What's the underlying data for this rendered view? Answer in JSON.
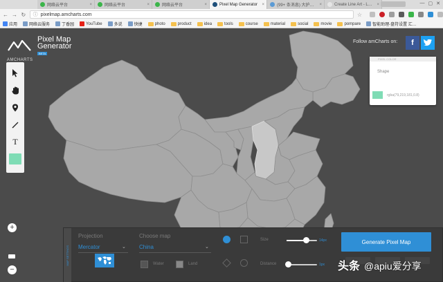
{
  "browser": {
    "tabs": [
      {
        "title": "网络云平台",
        "favicon_color": "#3bb54a",
        "active": false
      },
      {
        "title": "网络云平台",
        "favicon_color": "#3bb54a",
        "active": false
      },
      {
        "title": "网络云平台",
        "favicon_color": "#3bb54a",
        "active": false
      },
      {
        "title": "Pixel Map Generator",
        "favicon_color": "#1e4f7a",
        "active": true
      },
      {
        "title": "(99+ 条消息) 大护…",
        "favicon_color": "#5b9bd5",
        "active": false
      },
      {
        "title": "Create Line Art - L…",
        "favicon_color": "#e6e6e6",
        "active": false
      }
    ],
    "url": "pixelmap.amcharts.com",
    "bookmarks": [
      {
        "label": "应用",
        "kind": "apps"
      },
      {
        "label": "网络云服务",
        "kind": "site"
      },
      {
        "label": "丁香园",
        "kind": "site"
      },
      {
        "label": "YouTube",
        "kind": "youtube"
      },
      {
        "label": "多说",
        "kind": "site"
      },
      {
        "label": "快捷",
        "kind": "site"
      },
      {
        "label": "photo",
        "kind": "folder"
      },
      {
        "label": "product",
        "kind": "folder"
      },
      {
        "label": "idea",
        "kind": "folder"
      },
      {
        "label": "tools",
        "kind": "folder"
      },
      {
        "label": "course",
        "kind": "folder"
      },
      {
        "label": "material",
        "kind": "folder"
      },
      {
        "label": "social",
        "kind": "folder"
      },
      {
        "label": "movie",
        "kind": "folder"
      },
      {
        "label": "pompare",
        "kind": "folder"
      },
      {
        "label": "智能助理-盘符设置 汇…",
        "kind": "site"
      }
    ]
  },
  "header": {
    "brand": "AMCHARTS",
    "title_line1": "Pixel Map",
    "title_line2": "Generator",
    "beta": "BETA",
    "follow_text": "Follow amCharts on:",
    "facebook_label": "f"
  },
  "toolbar": {
    "tools": [
      {
        "name": "pointer-icon",
        "glyph": "pointer"
      },
      {
        "name": "hand-icon",
        "glyph": "hand"
      },
      {
        "name": "pin-icon",
        "glyph": "pin"
      },
      {
        "name": "line-icon",
        "glyph": "line"
      },
      {
        "name": "text-icon",
        "glyph": "T"
      }
    ],
    "selected_color": "#7fdcb5"
  },
  "color_popover": {
    "header": "PIXEL COLOR",
    "shape_label": "Shape",
    "color_value": "rgba(79,219,181,0.8)"
  },
  "zoom": {
    "zoom_in": "+",
    "zoom_out": "−"
  },
  "panel": {
    "side_label": "MAP SETTINGS",
    "projection_label": "Projection",
    "projection_value": "Mercator",
    "map_label": "Choose map",
    "map_value": "China",
    "water_label": "Water",
    "land_label": "Land",
    "size_label": "Size",
    "size_value": "14px",
    "distance_label": "Distance",
    "distance_value": "1px",
    "size_slider_fraction": 0.65,
    "distance_slider_fraction": 0.05,
    "generate_label": "Generate Pixel Map"
  },
  "watermark": {
    "prefix": "头条",
    "handle": "@apiu爱分享"
  },
  "colors": {
    "accent": "#2f8fd6",
    "map_region": "#a8a8a8",
    "map_highlight": "#c8c8c8",
    "background": "#4b4b4b"
  }
}
